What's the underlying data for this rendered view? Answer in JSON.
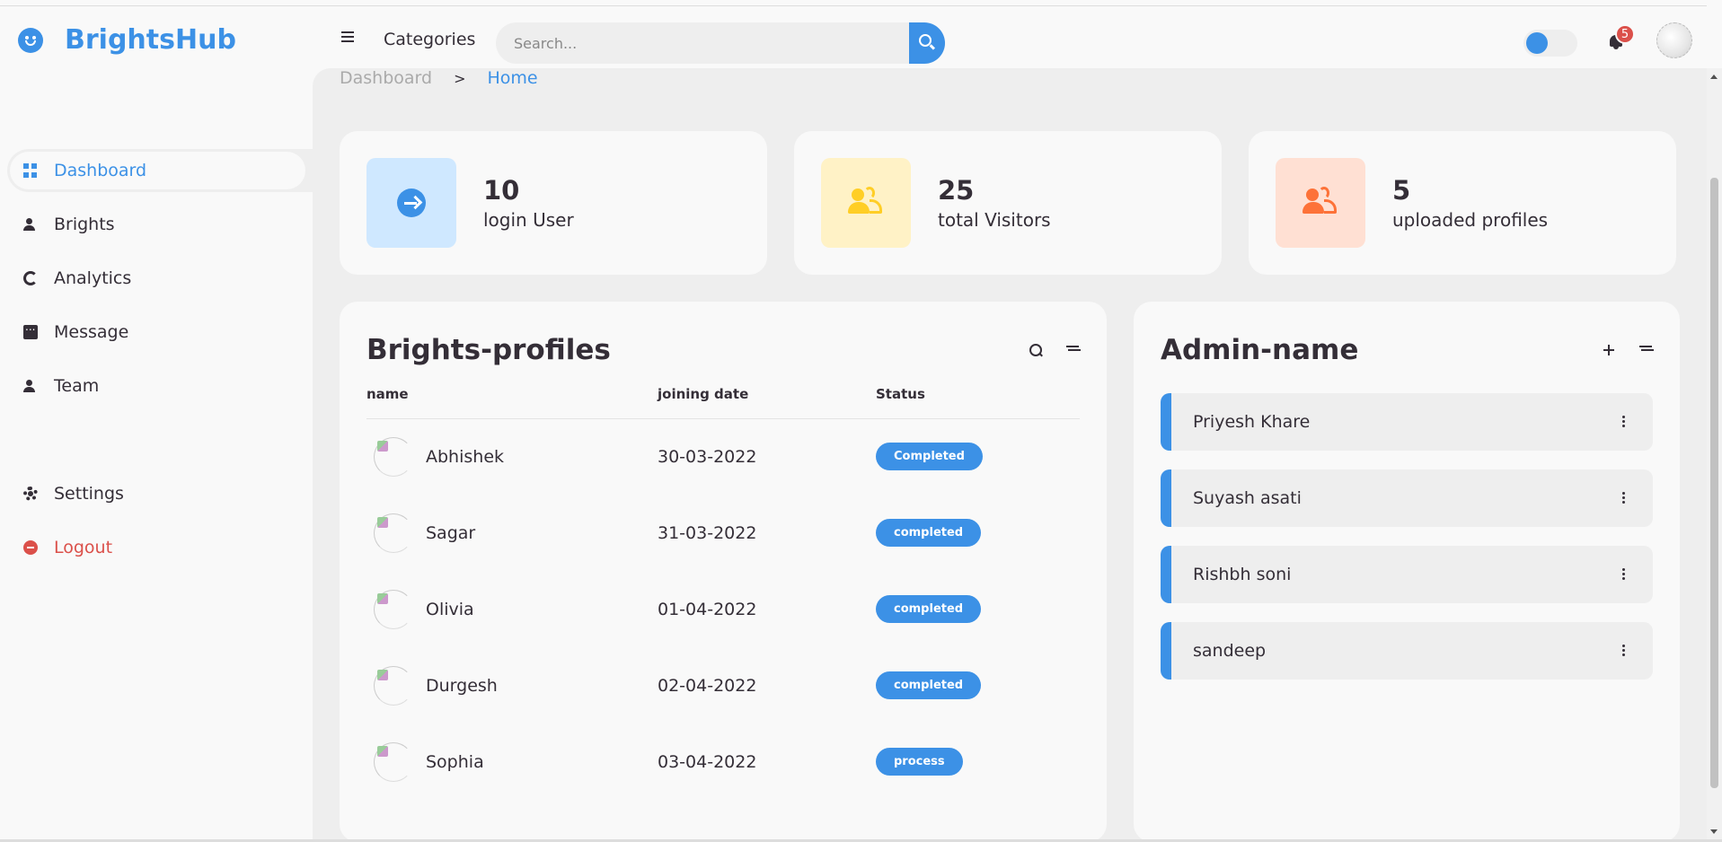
{
  "brand": {
    "name": "BrightsHub"
  },
  "header": {
    "categories_label": "Categories",
    "search_placeholder": "Search...",
    "notification_count": "5"
  },
  "sidebar": {
    "items": [
      {
        "label": "Dashboard",
        "icon": "dashboard-icon",
        "active": true
      },
      {
        "label": "Brights",
        "icon": "user-icon"
      },
      {
        "label": "Analytics",
        "icon": "pie-chart-icon"
      },
      {
        "label": "Message",
        "icon": "message-icon"
      },
      {
        "label": "Team",
        "icon": "user-icon"
      }
    ],
    "bottom": [
      {
        "label": "Settings",
        "icon": "gear-icon"
      },
      {
        "label": "Logout",
        "icon": "logout-icon"
      }
    ]
  },
  "breadcrumb": {
    "parent": "Dashboard",
    "separator": ">",
    "current": "Home"
  },
  "stats": [
    {
      "value": "10",
      "label": "login User",
      "icon": "login-arrow-icon",
      "color": "#3c91e6"
    },
    {
      "value": "25",
      "label": "total Visitors",
      "icon": "users-icon",
      "color": "#ffce26"
    },
    {
      "value": "5",
      "label": "uploaded profiles",
      "icon": "users-icon",
      "color": "#fd7238"
    }
  ],
  "profiles": {
    "title": "Brights-profiles",
    "columns": {
      "name": "name",
      "date": "joining date",
      "status": "Status"
    },
    "rows": [
      {
        "name": "Abhishek",
        "date": "30-03-2022",
        "status": "Completed"
      },
      {
        "name": "Sagar",
        "date": "31-03-2022",
        "status": "completed"
      },
      {
        "name": "Olivia",
        "date": "01-04-2022",
        "status": "completed"
      },
      {
        "name": "Durgesh",
        "date": "02-04-2022",
        "status": "completed"
      },
      {
        "name": "Sophia",
        "date": "03-04-2022",
        "status": "process"
      }
    ]
  },
  "admins": {
    "title": "Admin-name",
    "items": [
      "Priyesh Khare",
      "Suyash asati",
      "Rishbh soni",
      "sandeep"
    ]
  },
  "colors": {
    "accent": "#3c91e6",
    "danger": "#db504a",
    "background": "#eee"
  }
}
